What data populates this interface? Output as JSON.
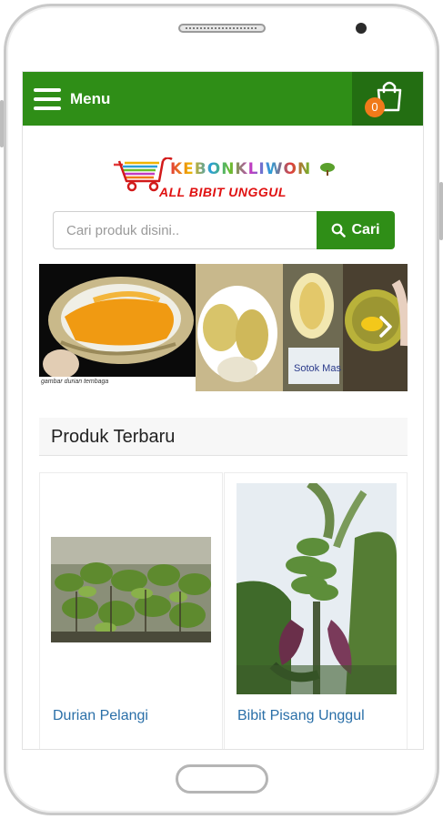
{
  "header": {
    "menu_label": "Menu",
    "cart_count": "0",
    "accent_color": "#2f8e17"
  },
  "logo": {
    "brand": "KEBONKLIWON",
    "tagline": "ALL BIBIT UNGGUL"
  },
  "search": {
    "placeholder": "Cari produk disini..",
    "value": "",
    "button_label": "Cari"
  },
  "banner": {
    "caption": "gambar durian tembaga",
    "photo_label": "Sotok Mas"
  },
  "section": {
    "title": "Produk Terbaru"
  },
  "products": [
    {
      "name": "Durian Pelangi"
    },
    {
      "name": "Bibit Pisang Unggul"
    }
  ],
  "icons": [
    "hamburger-icon",
    "shopping-bag-icon",
    "search-icon",
    "chevron-right-icon",
    "cart-logo-icon",
    "tree-icon"
  ]
}
